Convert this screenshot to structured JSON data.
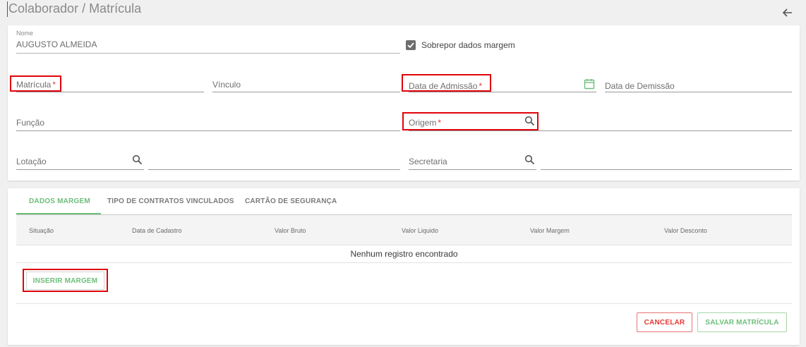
{
  "header": {
    "title": "Colaborador / Matrícula"
  },
  "form": {
    "nome": {
      "label": "Nome",
      "value": "AUGUSTO ALMEIDA"
    },
    "sobrepor": {
      "label": "Sobrepor dados margem",
      "checked": true
    },
    "matricula": {
      "label": "Matrícula",
      "required": "*"
    },
    "vinculo": {
      "label": "Vínculo"
    },
    "data_admissao": {
      "label": "Data de Admissão",
      "required": "*"
    },
    "data_demissao": {
      "label": "Data de Demissão"
    },
    "funcao": {
      "label": "Função"
    },
    "origem": {
      "label": "Origem",
      "required": "*"
    },
    "lotacao": {
      "label": "Lotação"
    },
    "secretaria": {
      "label": "Secretaria"
    }
  },
  "tabs": [
    {
      "label": "DADOS MARGEM",
      "active": true
    },
    {
      "label": "TIPO DE CONTRATOS VINCULADOS",
      "active": false
    },
    {
      "label": "CARTÃO DE SEGURANÇA",
      "active": false
    }
  ],
  "table": {
    "columns": [
      "Situação",
      "Data de Cadastro",
      "Valor Bruto",
      "Valor Liquido",
      "Valor Margem",
      "Valor Desconto"
    ],
    "empty_message": "Nenhum registro encontrado"
  },
  "buttons": {
    "insert": "INSERIR MARGEM",
    "cancel": "CANCELAR",
    "save": "SALVAR MATRÍCULA"
  },
  "colors": {
    "accent": "#6dbe7a",
    "danger": "#e53935",
    "highlight": "#e0040b"
  }
}
